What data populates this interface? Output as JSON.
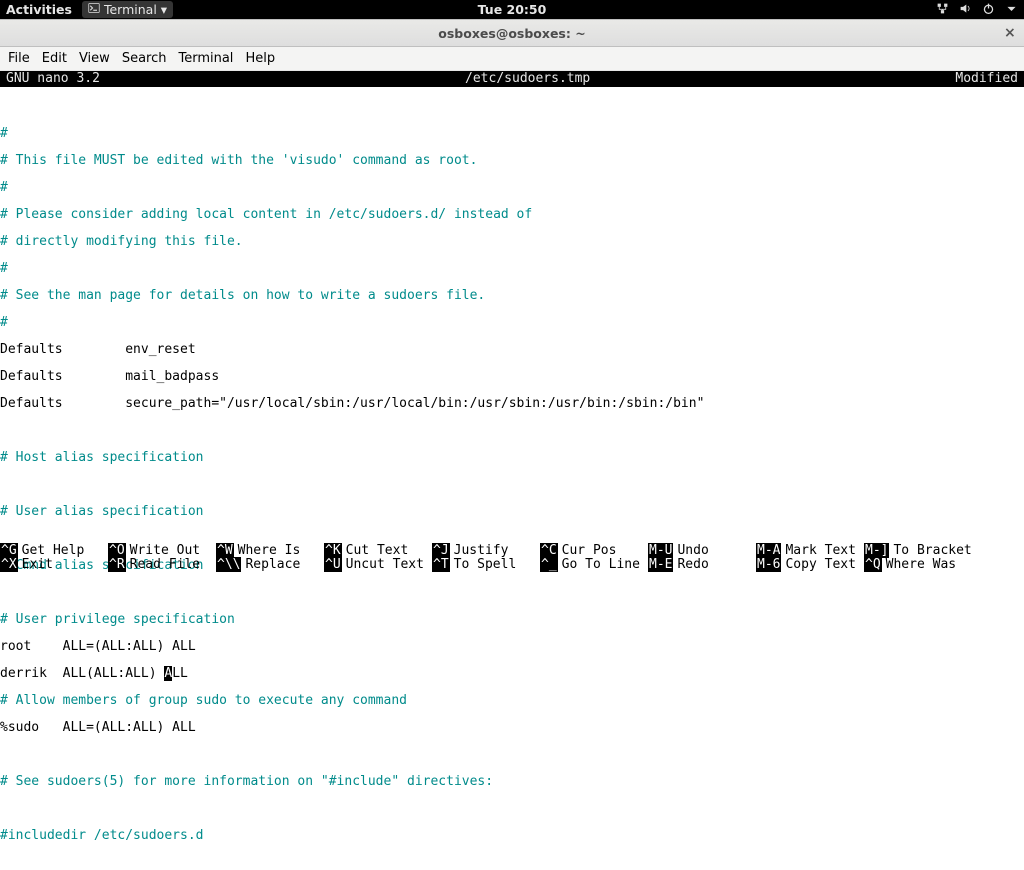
{
  "topbar": {
    "activities": "Activities",
    "app_label": "Terminal ▾",
    "clock": "Tue 20:50"
  },
  "titlebar": {
    "window_title": "osboxes@osboxes: ~"
  },
  "menubar": {
    "file": "File",
    "edit": "Edit",
    "view": "View",
    "search": "Search",
    "terminal": "Terminal",
    "help": "Help"
  },
  "nano_titlebar": {
    "version": "GNU nano 3.2",
    "filename": "/etc/sudoers.tmp",
    "status": "Modified"
  },
  "lines": {
    "l01": "#",
    "l02": "# This file MUST be edited with the 'visudo' command as root.",
    "l03": "#",
    "l04": "# Please consider adding local content in /etc/sudoers.d/ instead of",
    "l05": "# directly modifying this file.",
    "l06": "#",
    "l07": "# See the man page for details on how to write a sudoers file.",
    "l08": "#",
    "l09": "Defaults        env_reset",
    "l10": "Defaults        mail_badpass",
    "l11": "Defaults        secure_path=\"/usr/local/sbin:/usr/local/bin:/usr/sbin:/usr/bin:/sbin:/bin\"",
    "l12": "# Host alias specification",
    "l13": "# User alias specification",
    "l14": "# Cmnd alias specification",
    "l15": "# User privilege specification",
    "l16": "root    ALL=(ALL:ALL) ALL",
    "l17a": "derrik  ALL(ALL:ALL) ",
    "l17c": "A",
    "l17b": "LL",
    "l18": "# Allow members of group sudo to execute any command",
    "l19": "%sudo   ALL=(ALL:ALL) ALL",
    "l20": "# See sudoers(5) for more information on \"#include\" directives:",
    "l21": "#includedir /etc/sudoers.d"
  },
  "shortcuts": {
    "r1": {
      "k1": "^G",
      "l1": "Get Help",
      "k2": "^O",
      "l2": "Write Out",
      "k3": "^W",
      "l3": "Where Is",
      "k4": "^K",
      "l4": "Cut Text",
      "k5": "^J",
      "l5": "Justify",
      "k6": "^C",
      "l6": "Cur Pos",
      "k7": "M-U",
      "l7": "Undo",
      "k8": "M-A",
      "l8": "Mark Text",
      "k9": "M-]",
      "l9": "To Bracket"
    },
    "r2": {
      "k1": "^X",
      "l1": "Exit",
      "k2": "^R",
      "l2": "Read File",
      "k3": "^\\\\",
      "l3": "Replace",
      "k4": "^U",
      "l4": "Uncut Text",
      "k5": "^T",
      "l5": "To Spell",
      "k6": "^_",
      "l6": "Go To Line",
      "k7": "M-E",
      "l7": "Redo",
      "k8": "M-6",
      "l8": "Copy Text",
      "k9": "^Q",
      "l9": "Where Was"
    }
  }
}
